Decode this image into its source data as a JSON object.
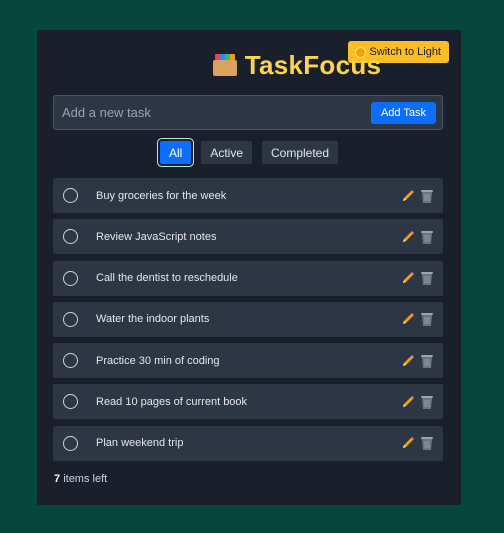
{
  "header": {
    "logo_icon": "card-file-box-icon",
    "title": "TaskFocus",
    "theme_toggle_label": "Switch to Light",
    "theme_toggle_icon": "sun-icon"
  },
  "add_task": {
    "placeholder": "Add a new task",
    "value": "",
    "button_label": "Add Task"
  },
  "filters": [
    {
      "label": "All",
      "active": true
    },
    {
      "label": "Active",
      "active": false
    },
    {
      "label": "Completed",
      "active": false
    }
  ],
  "tasks": [
    {
      "text": "Buy groceries for the week",
      "completed": false
    },
    {
      "text": "Review JavaScript notes",
      "completed": false
    },
    {
      "text": "Call the dentist to reschedule",
      "completed": false
    },
    {
      "text": "Water the indoor plants",
      "completed": false
    },
    {
      "text": "Practice 30 min of coding",
      "completed": false
    },
    {
      "text": "Read 10 pages of current book",
      "completed": false
    },
    {
      "text": "Plan weekend trip",
      "completed": false
    }
  ],
  "footer": {
    "count": "7",
    "suffix": "items left"
  },
  "colors": {
    "background": "#05473d",
    "panel": "#1a202b",
    "accent": "#0d6efd",
    "title": "#fcd34d",
    "theme_button": "#fbbf24"
  }
}
